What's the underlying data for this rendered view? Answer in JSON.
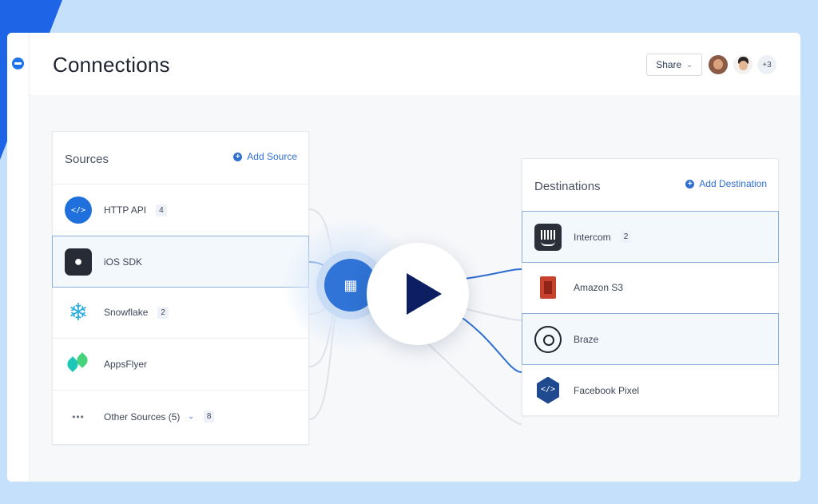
{
  "header": {
    "title": "Connections",
    "share_label": "Share",
    "extra_collaborators": "+3"
  },
  "sources": {
    "title": "Sources",
    "add_label": "Add Source",
    "items": [
      {
        "label": "HTTP API",
        "count": "4",
        "icon": "http-api-icon"
      },
      {
        "label": "iOS SDK",
        "count": "",
        "icon": "apple-icon"
      },
      {
        "label": "Snowflake",
        "count": "2",
        "icon": "snowflake-icon"
      },
      {
        "label": "AppsFlyer",
        "count": "",
        "icon": "appsflyer-icon"
      },
      {
        "label": "Other Sources (5)",
        "count": "8",
        "icon": "more-dots-icon"
      }
    ]
  },
  "destinations": {
    "title": "Destinations",
    "add_label": "Add Destination",
    "items": [
      {
        "label": "Intercom",
        "count": "2",
        "icon": "intercom-icon"
      },
      {
        "label": "Amazon S3",
        "count": "",
        "icon": "amazon-s3-icon"
      },
      {
        "label": "Braze",
        "count": "",
        "icon": "braze-icon"
      },
      {
        "label": "Facebook Pixel",
        "count": "",
        "icon": "facebook-pixel-icon"
      }
    ]
  },
  "colors": {
    "accent": "#2f6fd1",
    "hub": "#2f74d6",
    "play_icon": "#0d1e63",
    "page_bg": "#c5e0fb"
  }
}
